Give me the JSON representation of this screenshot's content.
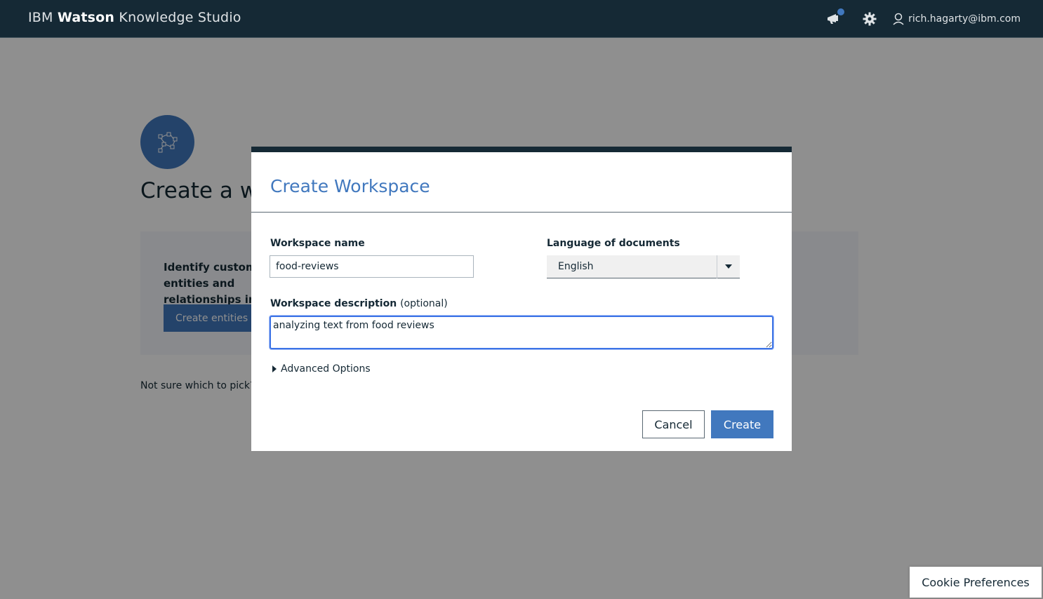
{
  "header": {
    "brand_prefix": "IBM",
    "brand_bold": "Watson",
    "brand_suffix": "Knowledge Studio",
    "user_email": "rich.hagarty@ibm.com",
    "icons": [
      "announcement-icon",
      "settings-icon",
      "user-icon"
    ]
  },
  "page": {
    "title": "Create a workspace",
    "card_text": "Identify custom entities and relationships in your data",
    "card_button": "Create entities and relationships workspace",
    "hint": "Not sure which to pick?"
  },
  "modal": {
    "title": "Create Workspace",
    "name_label": "Workspace name",
    "name_value": "food-reviews",
    "language_label": "Language of documents",
    "language_value": "English",
    "description_label": "Workspace description",
    "description_optional": "(optional)",
    "description_value": "analyzing text from food reviews",
    "advanced_label": "Advanced Options",
    "cancel_label": "Cancel",
    "create_label": "Create"
  },
  "cookie": {
    "label": "Cookie Preferences"
  },
  "colors": {
    "header_bg": "#152935",
    "accent": "#4178be",
    "focus": "#3b73e6"
  }
}
